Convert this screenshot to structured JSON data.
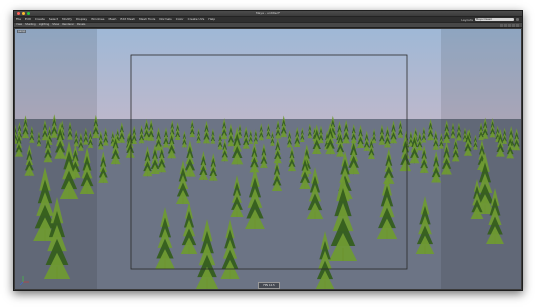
{
  "window": {
    "title": "Maya - untitled*",
    "traffic_lights": [
      "#ff5f57",
      "#febc2e",
      "#28c840"
    ]
  },
  "menubar": {
    "items": [
      "File",
      "Edit",
      "Create",
      "Select",
      "Modify",
      "Display",
      "Windows",
      "Mesh",
      "Edit Mesh",
      "Mesh Tools",
      "Normals",
      "Color",
      "Create UVs",
      "Help"
    ],
    "layout_label": "Layouts",
    "layout_value": "Maya Classic"
  },
  "panel_menu": {
    "items": [
      "View",
      "Shading",
      "Lighting",
      "Show",
      "Renderer",
      "Panels"
    ]
  },
  "viewport": {
    "camera_label": "persp",
    "hud_text": "FPS 12.5",
    "sky_top": "#9fb8d6",
    "sky_horizon": "#bcb8cc",
    "ground": "#6c7485",
    "tree_dark": "#355e1d",
    "tree_light": "#6f9a33",
    "gate_color": "#2a2a2a"
  }
}
